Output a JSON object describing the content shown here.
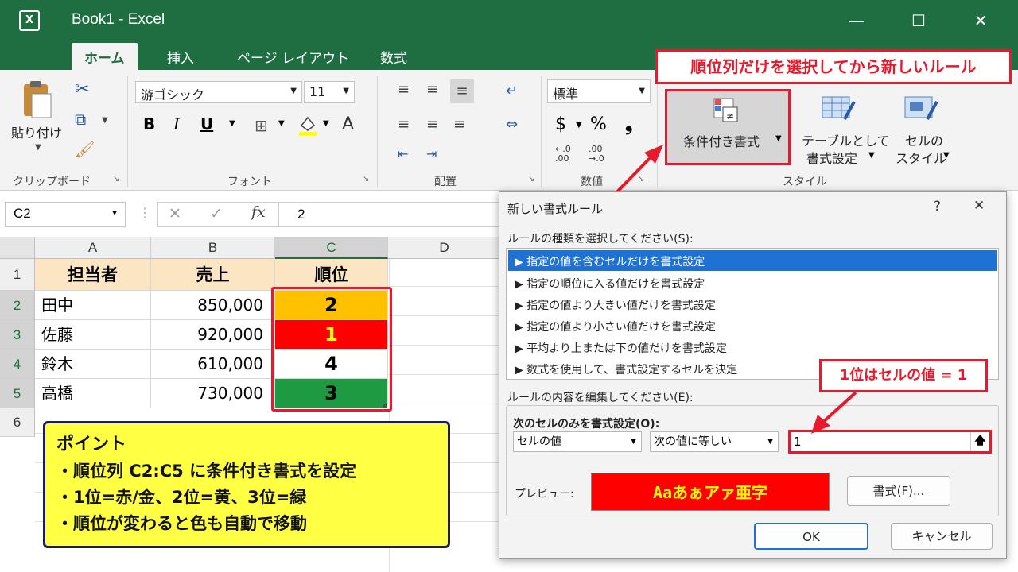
{
  "window": {
    "title": "Book1 - Excel",
    "app_icon": "X",
    "minimize": "—",
    "maximize": "☐",
    "close": "✕"
  },
  "tabs": [
    "ホーム",
    "挿入",
    "ページ レイアウト",
    "数式"
  ],
  "ribbon": {
    "paste_label": "貼り付け",
    "font_name": "游ゴシック",
    "font_size": "11",
    "number_format": "標準",
    "bold": "B",
    "italic": "I",
    "underline": "U",
    "font_color_letter": "A",
    "currency": "$",
    "percent": "%",
    "comma": "❟",
    "cond_format": "条件付き書式",
    "table_format_l1": "テーブルとして",
    "table_format_l2": "書式設定",
    "cell_style_l1": "セルの",
    "cell_style_l2": "スタイル",
    "groups": {
      "clipboard": "クリップボード",
      "font": "フォント",
      "alignment": "配置",
      "number": "数値",
      "style": "スタイル"
    },
    "dec_inc": "←.0\n.00",
    "dec_dec": ".00\n→.0"
  },
  "formula_bar": {
    "name_box": "C2",
    "fx": "fx",
    "value": "2",
    "cancel": "✕",
    "enter": "✓"
  },
  "columns": [
    "A",
    "B",
    "C",
    "D"
  ],
  "rows": [
    "1",
    "2",
    "3",
    "4",
    "5",
    "6"
  ],
  "sheet": {
    "header": [
      "担当者",
      "売上",
      "順位"
    ],
    "data": [
      {
        "name": "田中",
        "sales": "850,000",
        "rank": "2",
        "color": "#ffc000"
      },
      {
        "name": "佐藤",
        "sales": "920,000",
        "rank": "1",
        "color": "#ff0000",
        "text_color": "#ffff00"
      },
      {
        "name": "鈴木",
        "sales": "610,000",
        "rank": "4",
        "color": "#ffffff"
      },
      {
        "name": "高橋",
        "sales": "730,000",
        "rank": "3",
        "color": "#1e9a42"
      }
    ]
  },
  "callouts": {
    "top": "順位列だけを選択してから新しいルール",
    "value": "1位はセルの値 = 1"
  },
  "point_box": {
    "title": "ポイント",
    "items": [
      "・順位列 C2:C5 に条件付き書式を設定",
      "・1位=赤/金、2位=黄、3位=緑",
      "・順位が変わると色も自動で移動"
    ]
  },
  "dialog": {
    "title": "新しい書式ルール",
    "help": "?",
    "close": "✕",
    "rule_type_label": "ルールの種類を選択してください(S):",
    "rule_types": [
      "▶ 指定の値を含むセルだけを書式設定",
      "▶ 指定の順位に入る値だけを書式設定",
      "▶ 指定の値より大きい値だけを書式設定",
      "▶ 指定の値より小さい値だけを書式設定",
      "▶ 平均より上または下の値だけを書式設定",
      "▶ 数式を使用して、書式設定するセルを決定"
    ],
    "edit_label": "ルールの内容を編集してください(E):",
    "only_cells_label": "次のセルのみを書式設定(O):",
    "cond1": "セルの値",
    "cond2": "次の値に等しい",
    "value": "1",
    "preview_label": "プレビュー:",
    "preview_text": "Aaあぁアァ亜字",
    "preview_bg": "#ff0000",
    "preview_fg": "#ffff00",
    "format_btn": "書式(F)...",
    "ok": "OK",
    "cancel": "キャンセル"
  }
}
